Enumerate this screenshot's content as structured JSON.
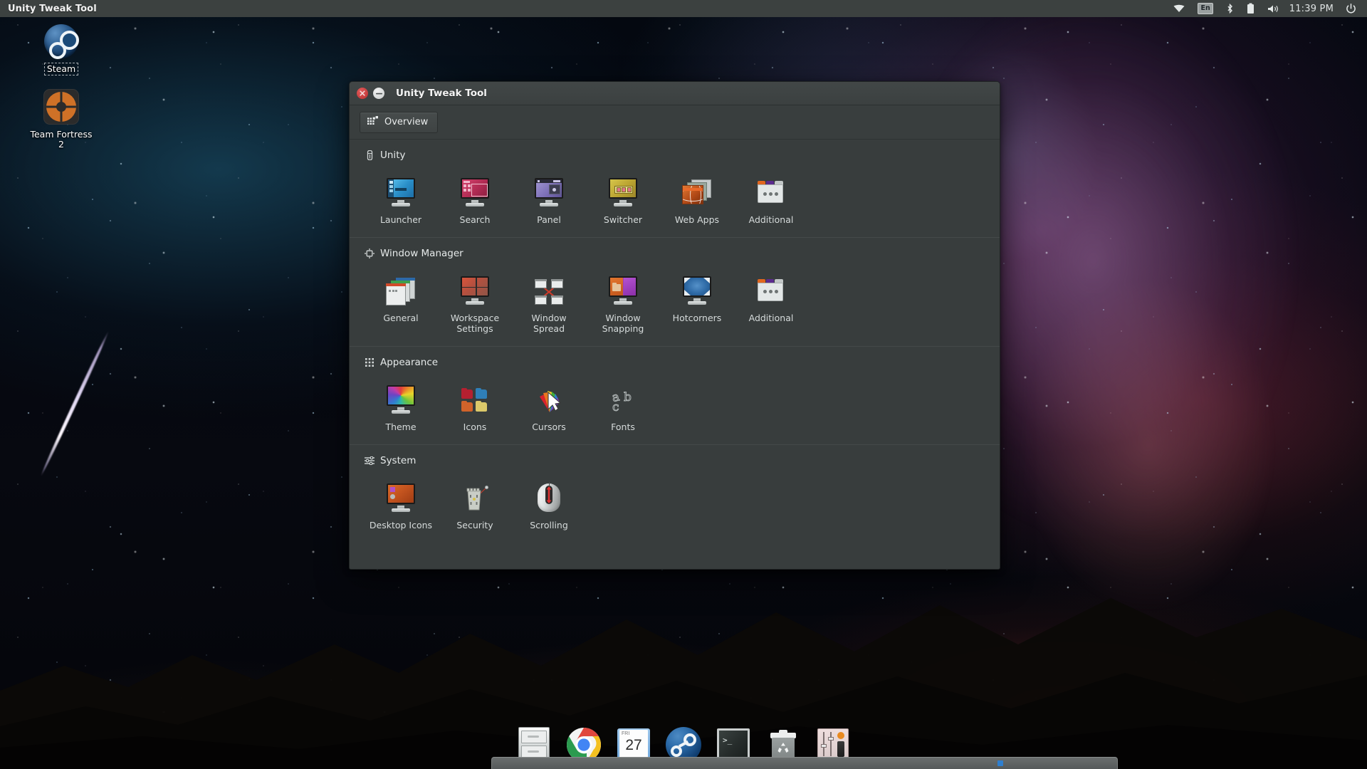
{
  "panel": {
    "title": "Unity Tweak Tool",
    "tray": [
      {
        "name": "wifi-icon",
        "label": "wifi"
      },
      {
        "name": "keyboard-layout-indicator",
        "label": "En"
      },
      {
        "name": "bluetooth-icon",
        "label": "bluetooth"
      },
      {
        "name": "battery-icon",
        "label": "battery"
      },
      {
        "name": "volume-icon",
        "label": "volume"
      }
    ],
    "clock": "11:39 PM",
    "power_label": "power"
  },
  "desktop_icons": [
    {
      "name": "steam",
      "label": "Steam",
      "selected": true
    },
    {
      "name": "team-fortress-2",
      "label": "Team Fortress 2",
      "selected": false
    }
  ],
  "window": {
    "title": "Unity Tweak Tool",
    "close_label": "Close",
    "minimize_label": "Minimize",
    "toolbar": {
      "overview_label": "Overview",
      "overview_icon": "dot-grid-icon"
    }
  },
  "sections": [
    {
      "id": "unity",
      "title": "Unity",
      "icon": "unity-icon",
      "tiles": [
        {
          "label": "Launcher",
          "icon": "monitor-launcher-icon"
        },
        {
          "label": "Search",
          "icon": "monitor-search-icon"
        },
        {
          "label": "Panel",
          "icon": "monitor-panel-icon"
        },
        {
          "label": "Switcher",
          "icon": "monitor-switcher-icon"
        },
        {
          "label": "Web Apps",
          "icon": "web-apps-icon"
        },
        {
          "label": "Additional",
          "icon": "additional-panel-icon"
        }
      ]
    },
    {
      "id": "window-manager",
      "title": "Window Manager",
      "icon": "window-manager-icon",
      "tiles": [
        {
          "label": "General",
          "icon": "stacked-windows-icon"
        },
        {
          "label": "Workspace Settings",
          "icon": "monitor-workspace-icon"
        },
        {
          "label": "Window Spread",
          "icon": "window-spread-icon"
        },
        {
          "label": "Window Snapping",
          "icon": "monitor-snapping-icon"
        },
        {
          "label": "Hotcorners",
          "icon": "monitor-hotcorners-icon"
        },
        {
          "label": "Additional",
          "icon": "additional-panel-icon"
        }
      ]
    },
    {
      "id": "appearance",
      "title": "Appearance",
      "icon": "appearance-grid-icon",
      "tiles": [
        {
          "label": "Theme",
          "icon": "monitor-theme-icon"
        },
        {
          "label": "Icons",
          "icon": "folders-icon"
        },
        {
          "label": "Cursors",
          "icon": "cursor-icon"
        },
        {
          "label": "Fonts",
          "icon": "fonts-abc-icon"
        }
      ]
    },
    {
      "id": "system",
      "title": "System",
      "icon": "system-sliders-icon",
      "tiles": [
        {
          "label": "Desktop Icons",
          "icon": "monitor-desktop-icons-icon"
        },
        {
          "label": "Security",
          "icon": "security-tower-icon"
        },
        {
          "label": "Scrolling",
          "icon": "mouse-scrolling-icon"
        }
      ]
    }
  ],
  "dock": {
    "items": [
      {
        "name": "file-manager-icon",
        "label": "Files"
      },
      {
        "name": "chrome-icon",
        "label": "Google Chrome"
      },
      {
        "name": "calendar-icon",
        "label": "Calendar",
        "day": "27",
        "weekday": "FRI"
      },
      {
        "name": "steam-icon",
        "label": "Steam"
      },
      {
        "name": "terminal-icon",
        "label": "Terminal"
      },
      {
        "name": "trash-icon",
        "label": "Trash"
      },
      {
        "name": "audio-mixer-icon",
        "label": "Mixer"
      }
    ]
  },
  "colors": {
    "panel_bg": "#3c4140",
    "window_bg": "#383d3d",
    "titlebar_bg": "#3f4444",
    "text": "#d6dbdb",
    "close_red": "#c93a3a",
    "accent_blue": "#2f7fd0"
  }
}
